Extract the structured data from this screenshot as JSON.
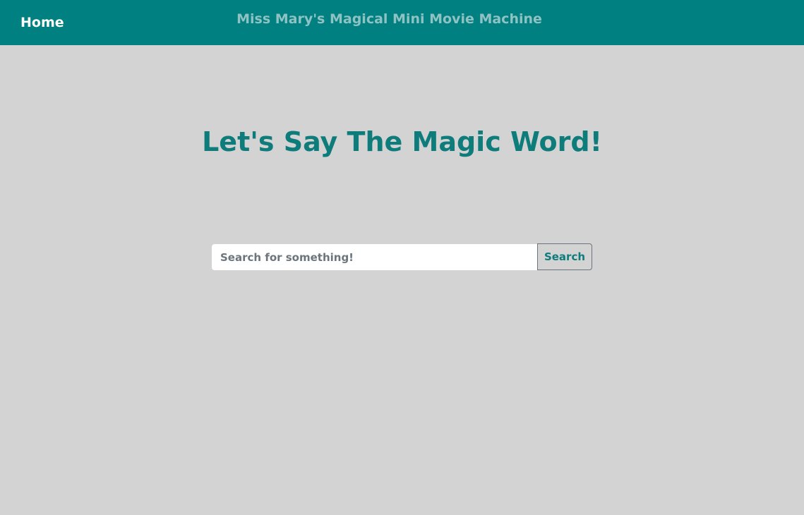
{
  "navbar": {
    "home_label": "Home",
    "title": "Miss Mary's Magical Mini Movie Machine"
  },
  "hero": {
    "heading": "Let's Say The Magic Word!"
  },
  "search": {
    "placeholder": "Search for something!",
    "value": "",
    "button_label": "Search"
  },
  "colors": {
    "navbar_background": "#008080",
    "page_background": "#d3d3d3",
    "accent_text": "#0f7c7c",
    "nav_title_text": "#8fc2c2",
    "button_border": "#6c757d"
  }
}
